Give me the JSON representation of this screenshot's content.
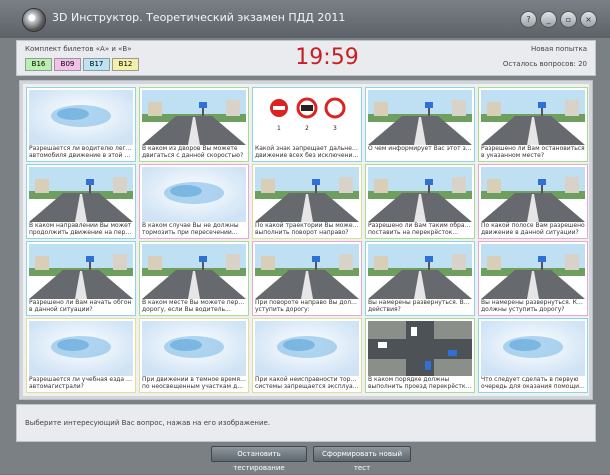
{
  "window": {
    "title": "3D Инструктор. Теоретический экзамен ПДД 2011"
  },
  "header": {
    "tickets_label": "Комплект билетов «А» и «В»",
    "tickets": [
      {
        "label": "В16",
        "color": "#b9f0b0"
      },
      {
        "label": "В09",
        "color": "#f2c0e8"
      },
      {
        "label": "В17",
        "color": "#b9e4f3"
      },
      {
        "label": "В12",
        "color": "#f3f0a8"
      }
    ],
    "timer": "19:59",
    "mode": "Новая попытка",
    "remaining": "Осталось вопросов: 20"
  },
  "cards": [
    {
      "color": "c-cyan",
      "icon": "intro-icon",
      "line1": "Разрешается ли водителю легкового",
      "line2": "автомобиля движение в этой полосе?"
    },
    {
      "color": "c-green",
      "icon": "road-scene-icon",
      "line1": "В каком из дворов Вы можете",
      "line2": "двигаться с данной скоростью?"
    },
    {
      "color": "c-cyan",
      "icon": "road-signs-icon",
      "line1": "Какой знак запрещает дальнейшее",
      "line2": "движение всех без исключения тс?"
    },
    {
      "color": "c-cyan",
      "icon": "road-scene-icon",
      "line1": "О чем информирует Вас этот знак?",
      "line2": ""
    },
    {
      "color": "c-green",
      "icon": "road-scene-icon",
      "line1": "Разрешено ли Вам остановиться",
      "line2": "в указанном месте?"
    },
    {
      "color": "c-cyan",
      "icon": "road-scene-icon",
      "line1": "В каком направлении Вы может",
      "line2": "продолжить движение на перекрёстке?"
    },
    {
      "color": "c-pink",
      "icon": "intro-icon",
      "line1": "В каком случае Вы не должны",
      "line2": "тормозить при пересечении..."
    },
    {
      "color": "c-yellow",
      "icon": "road-scene-icon",
      "line1": "По какой траектории Вы можете",
      "line2": "выполнить поворот направо?"
    },
    {
      "color": "c-green",
      "icon": "road-scene-icon",
      "line1": "Разрешено ли Вам таким образом",
      "line2": "поставить на перекрёсток..."
    },
    {
      "color": "c-pink",
      "icon": "road-scene-icon",
      "line1": "По какой полосе Вам разрешено",
      "line2": "движение в данной ситуации?"
    },
    {
      "color": "c-cyan",
      "icon": "road-scene-icon",
      "line1": "Разрешено ли Вам начать обгон",
      "line2": "в данной ситуации?"
    },
    {
      "color": "c-green",
      "icon": "road-scene-icon",
      "line1": "В каком месте Вы можете пересечь",
      "line2": "дорогу, если Вы водитель..."
    },
    {
      "color": "c-pink",
      "icon": "road-scene-icon",
      "line1": "При повороте направо Вы должны",
      "line2": "уступить дорогу:"
    },
    {
      "color": "c-cyan",
      "icon": "road-scene-icon",
      "line1": "Вы намерены развернуться. Ваши",
      "line2": "действия?"
    },
    {
      "color": "c-pink",
      "icon": "road-scene-icon",
      "line1": "Вы намерены развернуться. Кому Вы",
      "line2": "должны уступить дорогу?"
    },
    {
      "color": "c-yellow",
      "icon": "intro-icon",
      "line1": "Разрешается ли учебная езда на",
      "line2": "автомагистрали?"
    },
    {
      "color": "c-yellow",
      "icon": "intro-icon",
      "line1": "При движении в темное время суток",
      "line2": "по неосвещенным участкам дорог..."
    },
    {
      "color": "c-yellow",
      "icon": "intro-icon",
      "line1": "При какой неисправности тормозной",
      "line2": "системы запрещается эксплуатация..."
    },
    {
      "color": "c-green",
      "icon": "intersection-diagram-icon",
      "line1": "В каком порядке должны",
      "line2": "выполнить проезд перекрёстка?"
    },
    {
      "color": "c-cyan",
      "icon": "intro-icon",
      "line1": "Что следует сделать в первую",
      "line2": "очередь для оказания помощи..."
    }
  ],
  "footer": {
    "prompt": "Выберите интересующий Вас вопрос, нажав на его изображение.",
    "stop_button": "Остановить тестирование",
    "save_button": "Сформировать новый тест"
  }
}
